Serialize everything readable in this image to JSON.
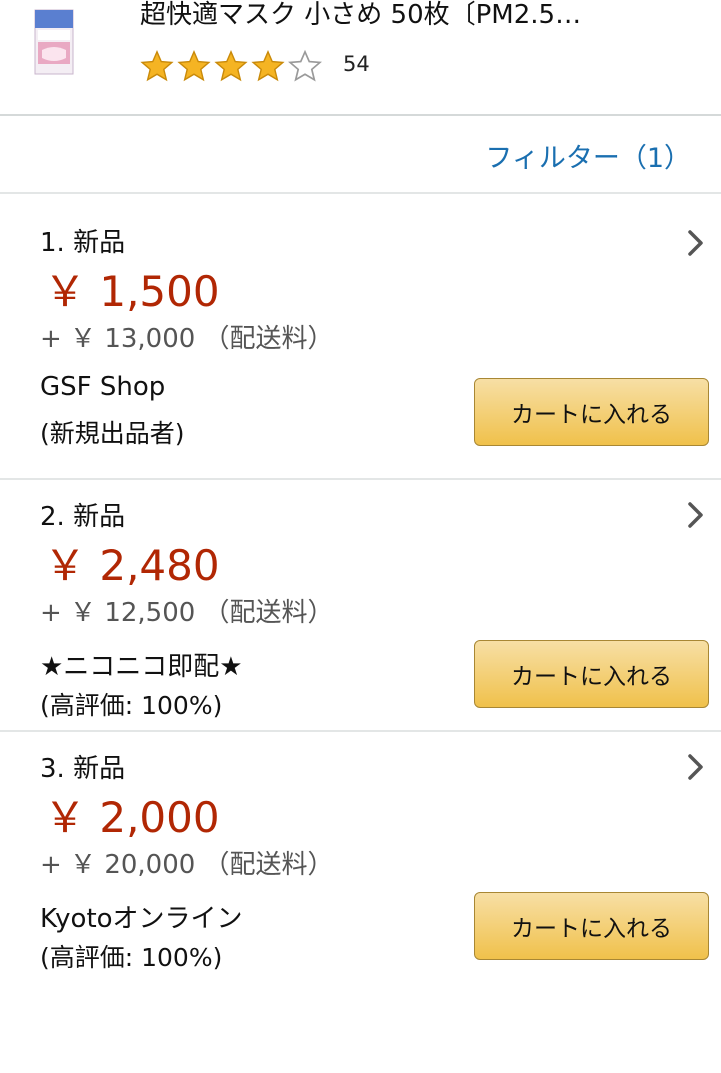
{
  "product": {
    "title": "超快適マスク 小さめ 50枚〔PM2.5…",
    "rating": 4,
    "rating_max": 5,
    "rating_count": "54"
  },
  "filter": {
    "label": "フィルター（1）"
  },
  "offers": [
    {
      "condition": "1. 新品",
      "price": "￥ 1,500",
      "shipping": "+ ￥ 13,000 （配送料）",
      "seller": "GSF Shop",
      "seller_info": "(新規出品者)",
      "cart_label": "カートに入れる"
    },
    {
      "condition": "2. 新品",
      "price": "￥ 2,480",
      "shipping": "+ ￥ 12,500 （配送料）",
      "seller": "★ニコニコ即配★",
      "seller_info": "(高評価: 100%)",
      "cart_label": "カートに入れる"
    },
    {
      "condition": "3. 新品",
      "price": "￥ 2,000",
      "shipping": "+ ￥ 20,000 （配送料）",
      "seller": "Kyotoオンライン",
      "seller_info": "(高評価: 100%)",
      "cart_label": "カートに入れる"
    }
  ],
  "colors": {
    "price": "#b12704",
    "link": "#1a6fb0",
    "star": "#f5b423",
    "button": "#f0c14b"
  }
}
